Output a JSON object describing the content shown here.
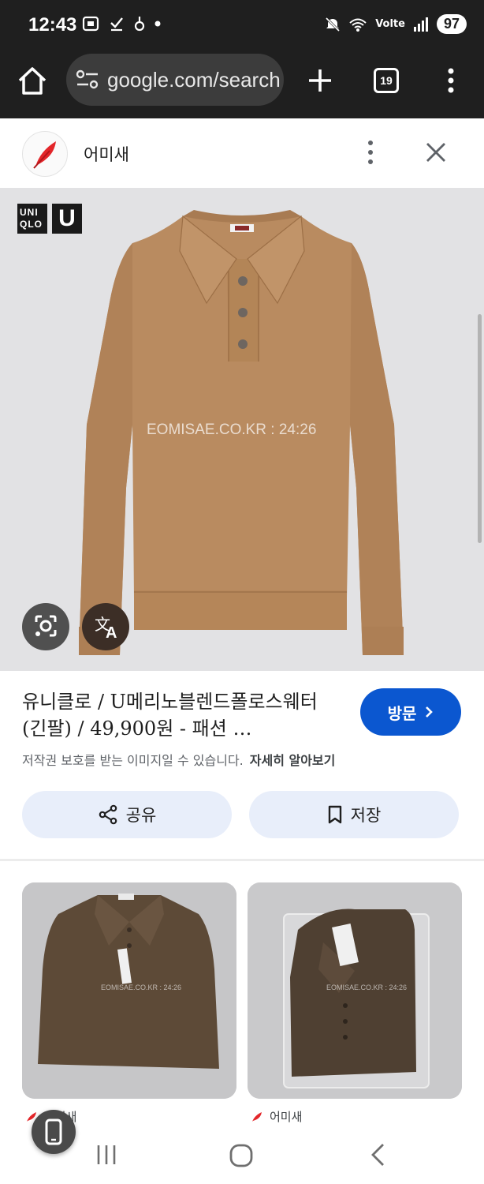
{
  "status_bar": {
    "time": "12:43",
    "network": "Volte",
    "battery": "97"
  },
  "browser": {
    "url": "google.com/search",
    "tab_count": "19"
  },
  "sheet": {
    "site_name": "어미새"
  },
  "image": {
    "watermark": "EOMISAE.CO.KR : 24:26",
    "brand_logo_text": "UNIQLO",
    "brand_logo_letter": "U"
  },
  "result": {
    "title": "유니클로 / U메리노블렌드폴로스웨터 (긴팔) / 49,900원 - 패션 …",
    "visit_label": "방문",
    "copyright": "저작권 보호를 받는 이미지일 수 있습니다.",
    "learn_more": "자세히 알아보기",
    "share_label": "공유",
    "save_label": "저장"
  },
  "related": [
    {
      "source": "어미새"
    },
    {
      "source": "어미새"
    }
  ],
  "colors": {
    "accent": "#0b57d0",
    "brand_red": "#e3262a",
    "sweater_tan": "#b98b60"
  }
}
